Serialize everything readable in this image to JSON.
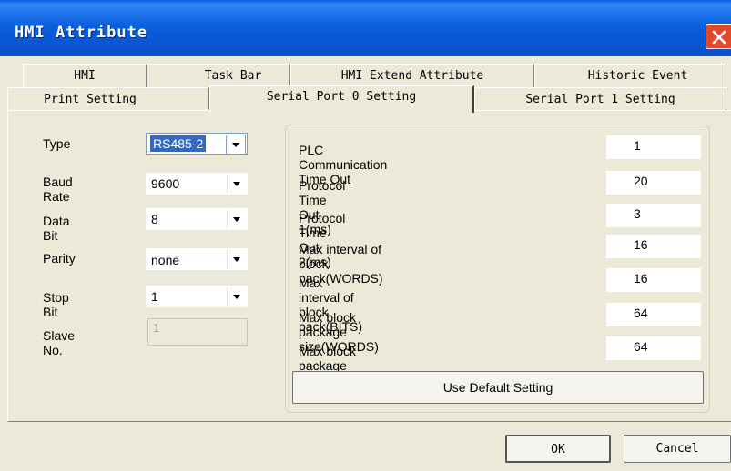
{
  "window": {
    "title": "HMI Attribute"
  },
  "tabs_row1": [
    "HMI",
    "Task Bar",
    "HMI Extend Attribute",
    "Historic Event"
  ],
  "tabs_row2": [
    "Print Setting",
    "Serial Port 0 Setting",
    "Serial Port 1 Setting"
  ],
  "active_tab": "Serial Port 0 Setting",
  "left": {
    "type": {
      "label": "Type",
      "value": "RS485-2"
    },
    "baud": {
      "label": "Baud Rate",
      "value": "9600"
    },
    "data_bit": {
      "label": "Data Bit",
      "value": "8"
    },
    "parity": {
      "label": "Parity",
      "value": "none"
    },
    "stop_bit": {
      "label": "Stop Bit",
      "value": "1"
    },
    "slave": {
      "label": "Slave No.",
      "value": "1"
    }
  },
  "settings": [
    {
      "label": "PLC Communication Time Out",
      "value": "1"
    },
    {
      "label": "Protocol Time Out 1(ms)",
      "value": "20"
    },
    {
      "label": "Protocol Time Out 2(ms)",
      "value": "3"
    },
    {
      "label": "Max interval of block pack(WORDS)",
      "value": "16"
    },
    {
      "label": "Max interval of block pack(BITS)",
      "value": "16"
    },
    {
      "label": "Max block package size(WORDS)",
      "value": "64"
    },
    {
      "label": "Max block package size(BITS)",
      "value": "64"
    }
  ],
  "buttons": {
    "default": "Use Default Setting",
    "ok": "OK",
    "cancel": "Cancel"
  }
}
